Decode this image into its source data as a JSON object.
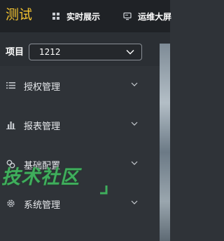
{
  "header": {
    "logo": "测试",
    "nav": [
      {
        "label": "实时展示",
        "icon": "grid-icon"
      },
      {
        "label": "运维大屏",
        "icon": "monitor-icon"
      }
    ]
  },
  "project": {
    "label": "项目",
    "selected": "1212"
  },
  "sidebar": {
    "items": [
      {
        "label": "授权管理",
        "icon": "list-icon"
      },
      {
        "label": "报表管理",
        "icon": "bar-chart-icon"
      },
      {
        "label": "基础配置",
        "icon": "link-icon"
      },
      {
        "label": "系统管理",
        "icon": "gear-icon"
      }
    ]
  },
  "watermark": {
    "text": "技术社区"
  },
  "colors": {
    "logo": "#f2c230",
    "topbar": "#1f2226",
    "sidebar": "#2f3338",
    "watermark": "#3fae5c"
  }
}
